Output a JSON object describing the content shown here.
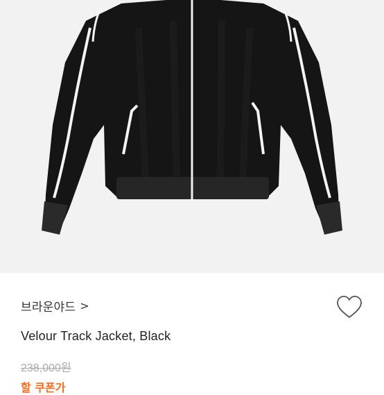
{
  "product": {
    "image_alt": "Velour Track Jacket",
    "brand": "브라운야드",
    "brand_chevron": ">",
    "title": "Velour Track Jacket, Black",
    "original_price": "238,000원",
    "discount_label": "할 쿠폰가"
  },
  "icons": {
    "wishlist": "heart-icon",
    "brand_link": "chevron-right-icon"
  },
  "colors": {
    "image_background": "#f2f2f2",
    "jacket": "#141414",
    "piping": "#ffffff",
    "text": "#222222",
    "strikethrough_price": "#aaaaaa",
    "accent": "#ff6a1a"
  }
}
